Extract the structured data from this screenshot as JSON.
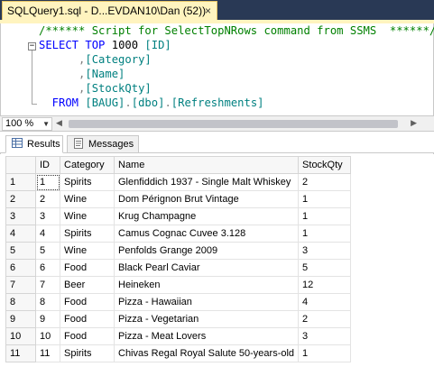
{
  "document_tab": {
    "title": "SQLQuery1.sql - D...EVDAN10\\Dan (52))",
    "close_glyph": "×"
  },
  "editor": {
    "collapse_glyph": "−",
    "lines": [
      [
        {
          "t": "/****** Script for SelectTopNRows command from SSMS  ******/",
          "c": "c-comment"
        }
      ],
      [
        {
          "t": "SELECT ",
          "c": "c-kw"
        },
        {
          "t": "TOP ",
          "c": "c-kw"
        },
        {
          "t": "1000 ",
          "c": "c-black"
        },
        {
          "t": "[ID]",
          "c": "c-ident"
        }
      ],
      [
        {
          "t": "      ,",
          "c": "c-gray"
        },
        {
          "t": "[Category]",
          "c": "c-ident"
        }
      ],
      [
        {
          "t": "      ,",
          "c": "c-gray"
        },
        {
          "t": "[Name]",
          "c": "c-ident"
        }
      ],
      [
        {
          "t": "      ,",
          "c": "c-gray"
        },
        {
          "t": "[StockQty]",
          "c": "c-ident"
        }
      ],
      [
        {
          "t": "  FROM ",
          "c": "c-kw"
        },
        {
          "t": "[BAUG]",
          "c": "c-ident"
        },
        {
          "t": ".",
          "c": "c-gray"
        },
        {
          "t": "[dbo]",
          "c": "c-ident"
        },
        {
          "t": ".",
          "c": "c-gray"
        },
        {
          "t": "[Refreshments]",
          "c": "c-ident"
        }
      ]
    ]
  },
  "zoom": {
    "value": "100 %"
  },
  "results_tabs": {
    "results_label": "Results",
    "messages_label": "Messages"
  },
  "grid": {
    "columns": [
      "ID",
      "Category",
      "Name",
      "StockQty"
    ],
    "rows": [
      {
        "n": "1",
        "id": "1",
        "category": "Spirits",
        "name": "Glenfiddich 1937 - Single Malt Whiskey",
        "qty": "2"
      },
      {
        "n": "2",
        "id": "2",
        "category": "Wine",
        "name": "Dom Pérignon Brut Vintage",
        "qty": "1"
      },
      {
        "n": "3",
        "id": "3",
        "category": "Wine",
        "name": "Krug Champagne",
        "qty": "1"
      },
      {
        "n": "4",
        "id": "4",
        "category": "Spirits",
        "name": "Camus Cognac Cuvee 3.128",
        "qty": "1"
      },
      {
        "n": "5",
        "id": "5",
        "category": "Wine",
        "name": "Penfolds Grange 2009",
        "qty": "3"
      },
      {
        "n": "6",
        "id": "6",
        "category": "Food",
        "name": "Black Pearl Caviar",
        "qty": "5"
      },
      {
        "n": "7",
        "id": "7",
        "category": "Beer",
        "name": "Heineken",
        "qty": "12"
      },
      {
        "n": "8",
        "id": "8",
        "category": "Food",
        "name": "Pizza - Hawaiian",
        "qty": "4"
      },
      {
        "n": "9",
        "id": "9",
        "category": "Food",
        "name": "Pizza - Vegetarian",
        "qty": "2"
      },
      {
        "n": "10",
        "id": "10",
        "category": "Food",
        "name": "Pizza - Meat Lovers",
        "qty": "3"
      },
      {
        "n": "11",
        "id": "11",
        "category": "Spirits",
        "name": "Chivas Regal Royal Salute 50-years-old",
        "qty": "1"
      }
    ]
  },
  "colors": {
    "tabstrip_bg": "#293955",
    "active_tab_bg": "#fff4bf",
    "comment": "#008000",
    "keyword": "#0000ff",
    "identifier": "#008080"
  }
}
